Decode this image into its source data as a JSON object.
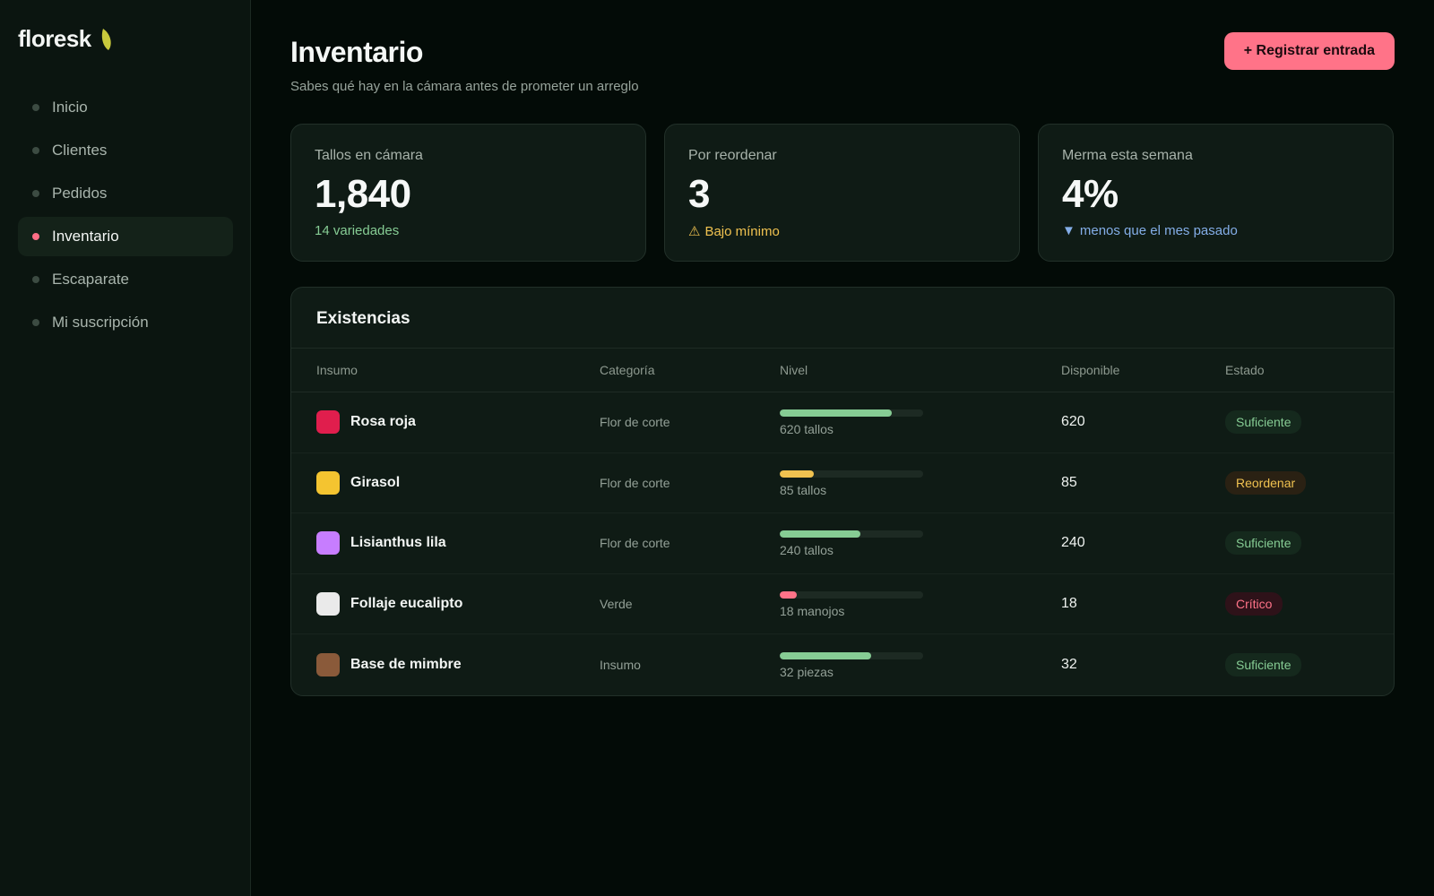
{
  "brand": {
    "name": "floresk",
    "leaf_color": "#c8c93c"
  },
  "sidebar": {
    "items": [
      {
        "label": "Inicio",
        "active": false
      },
      {
        "label": "Clientes",
        "active": false
      },
      {
        "label": "Pedidos",
        "active": false
      },
      {
        "label": "Inventario",
        "active": true
      },
      {
        "label": "Escaparate",
        "active": false
      },
      {
        "label": "Mi suscripción",
        "active": false
      }
    ]
  },
  "header": {
    "title": "Inventario",
    "subtitle": "Sabes qué hay en la cámara antes de prometer un arreglo",
    "action_label": "+ Registrar entrada"
  },
  "stats": [
    {
      "label": "Tallos en cámara",
      "value": "1,840",
      "note": "14 variedades",
      "note_icon": "",
      "tone": "green"
    },
    {
      "label": "Por reordenar",
      "value": "3",
      "note": "Bajo mínimo",
      "note_icon": "⚠",
      "tone": "amber"
    },
    {
      "label": "Merma esta semana",
      "value": "4%",
      "note": "menos que el mes pasado",
      "note_icon": "▼",
      "tone": "blue"
    }
  ],
  "table": {
    "title": "Existencias",
    "columns": [
      "Insumo",
      "Categoría",
      "Nivel",
      "Disponible",
      "Estado"
    ],
    "rows": [
      {
        "name": "Rosa roja",
        "swatch": "#e01e4d",
        "category": "Flor de corte",
        "level": 0.78,
        "level_color": "#86cc94",
        "level_text": "620 tallos",
        "available": "620",
        "status": "Suficiente",
        "status_kind": "ok"
      },
      {
        "name": "Girasol",
        "swatch": "#f4c430",
        "category": "Flor de corte",
        "level": 0.24,
        "level_color": "#f0c250",
        "level_text": "85 tallos",
        "available": "85",
        "status": "Reordenar",
        "status_kind": "warn"
      },
      {
        "name": "Lisianthus lila",
        "swatch": "#c77dff",
        "category": "Flor de corte",
        "level": 0.56,
        "level_color": "#86cc94",
        "level_text": "240 tallos",
        "available": "240",
        "status": "Suficiente",
        "status_kind": "ok"
      },
      {
        "name": "Follaje eucalipto",
        "swatch": "#eaeaea",
        "category": "Verde",
        "level": 0.12,
        "level_color": "#ff7388",
        "level_text": "18 manojos",
        "available": "18",
        "status": "Crítico",
        "status_kind": "crit"
      },
      {
        "name": "Base de mimbre",
        "swatch": "#8a5a3a",
        "category": "Insumo",
        "level": 0.64,
        "level_color": "#86cc94",
        "level_text": "32 piezas",
        "available": "32",
        "status": "Suficiente",
        "status_kind": "ok"
      }
    ]
  },
  "colors": {
    "accent": "#ff7388",
    "success": "#86cc94",
    "warning": "#f0c250",
    "info": "#84aee8"
  }
}
